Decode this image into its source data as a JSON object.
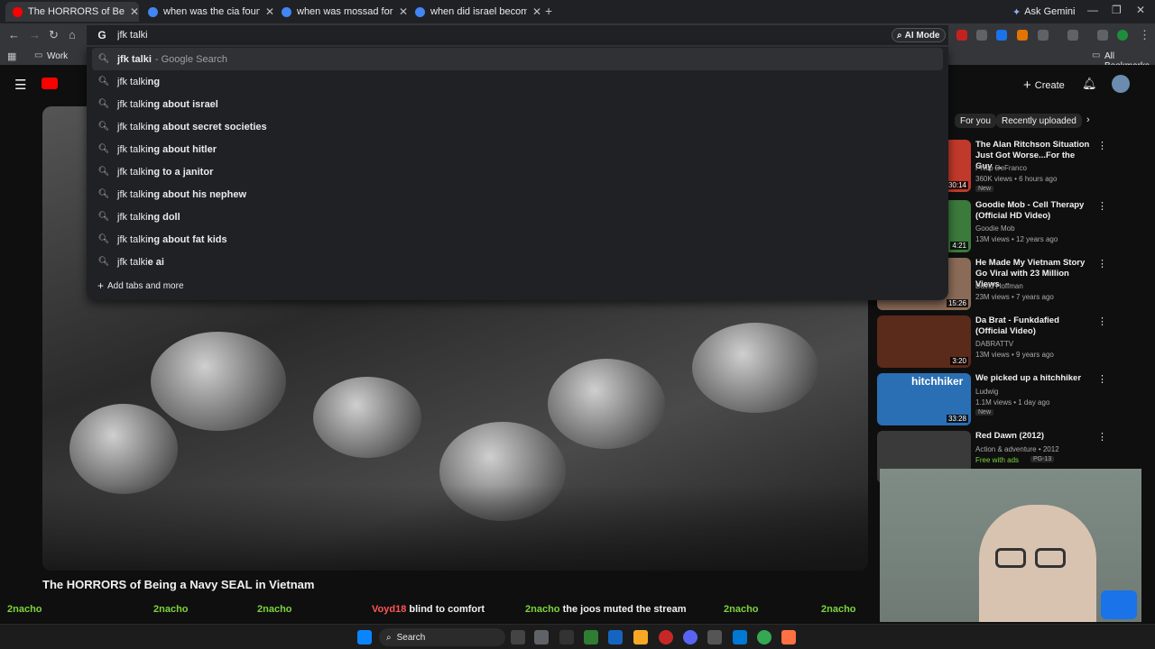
{
  "browser": {
    "tabs": [
      {
        "title": "The HORRORS of Being a Navy",
        "active": true,
        "favicon_color": "#ff0000"
      },
      {
        "title": "when was the cia founded - Go",
        "active": false,
        "favicon_color": "#4285f4"
      },
      {
        "title": "when was mossad formed - Go",
        "active": false,
        "favicon_color": "#4285f4"
      },
      {
        "title": "when did israel become a natio",
        "active": false,
        "favicon_color": "#4285f4"
      }
    ],
    "new_tab": "+",
    "ask_gemini": "Ask Gemini",
    "omnibox_value": "jfk talki",
    "ai_mode": "AI Mode",
    "bookmarks": {
      "work": "Work",
      "all": "All Bookmarks"
    }
  },
  "dropdown": {
    "first": {
      "bold": "jfk talki",
      "hint": "- Google Search"
    },
    "suggestions": [
      {
        "prefix": "jfk talki",
        "rest": "ng"
      },
      {
        "prefix": "jfk talki",
        "rest": "ng about israel"
      },
      {
        "prefix": "jfk talki",
        "rest": "ng about secret societies"
      },
      {
        "prefix": "jfk talki",
        "rest": "ng about hitler"
      },
      {
        "prefix": "jfk talki",
        "rest": "ng to a janitor"
      },
      {
        "prefix": "jfk talki",
        "rest": "ng about his nephew"
      },
      {
        "prefix": "jfk talki",
        "rest": "ng doll"
      },
      {
        "prefix": "jfk talki",
        "rest": "ng about fat kids"
      },
      {
        "prefix": "jfk talki",
        "rest": "e ai"
      }
    ],
    "add_tabs": "Add tabs and more"
  },
  "youtube": {
    "create": "Create",
    "chips": {
      "for_you": "For you",
      "recent": "Recently uploaded"
    },
    "video_title": "The HORRORS of Being a Navy SEAL in Vietnam",
    "sidebar": [
      {
        "title": "The Alan Ritchson Situation Just Got Worse...For the Guy ...",
        "channel": "Philip DeFranco",
        "meta": "360K views • 6 hours ago",
        "badge": "New",
        "duration": "30:14",
        "thumb_color": "#c0392b"
      },
      {
        "title": "Goodie Mob - Cell Therapy (Official HD Video)",
        "channel": "Goodie Mob",
        "meta": "13M views • 12 years ago",
        "badge": "",
        "duration": "4:21",
        "thumb_color": "#3b7a3b"
      },
      {
        "title": "He Made My Vietnam Story Go Viral with 23 Million Views",
        "channel": "David Hoffman",
        "meta": "23M views • 7 years ago",
        "badge": "",
        "duration": "15:26",
        "thumb_color": "#8a6b57"
      },
      {
        "title": "Da Brat - Funkdafied (Official Video)",
        "channel": "DABRATTV",
        "meta": "13M views • 9 years ago",
        "badge": "",
        "duration": "3:20",
        "thumb_color": "#5a2a1a"
      },
      {
        "title": "We picked up a hitchhiker",
        "channel": "Ludwig",
        "meta": "1.1M views • 1 day ago",
        "badge": "New",
        "duration": "33:28",
        "thumb_color": "#2a6fb3",
        "overlay": "hitchhiker"
      },
      {
        "title": "Red Dawn (2012)",
        "channel": "Action & adventure • 2012",
        "meta": "Free with ads",
        "badge": "PG-13",
        "duration": "",
        "thumb_color": "#3a3a3a"
      }
    ]
  },
  "ticker": [
    {
      "user": "2nacho",
      "text": ""
    },
    {
      "user": "2nacho",
      "text": ""
    },
    {
      "user": "2nacho",
      "text": ""
    },
    {
      "user": "Voyd18",
      "text": "blind to comfort"
    },
    {
      "user": "2nacho",
      "text": "the joos muted the stream"
    },
    {
      "user": "2nacho",
      "text": ""
    },
    {
      "user": "2nacho",
      "text": ""
    }
  ],
  "taskbar": {
    "search": "Search"
  }
}
